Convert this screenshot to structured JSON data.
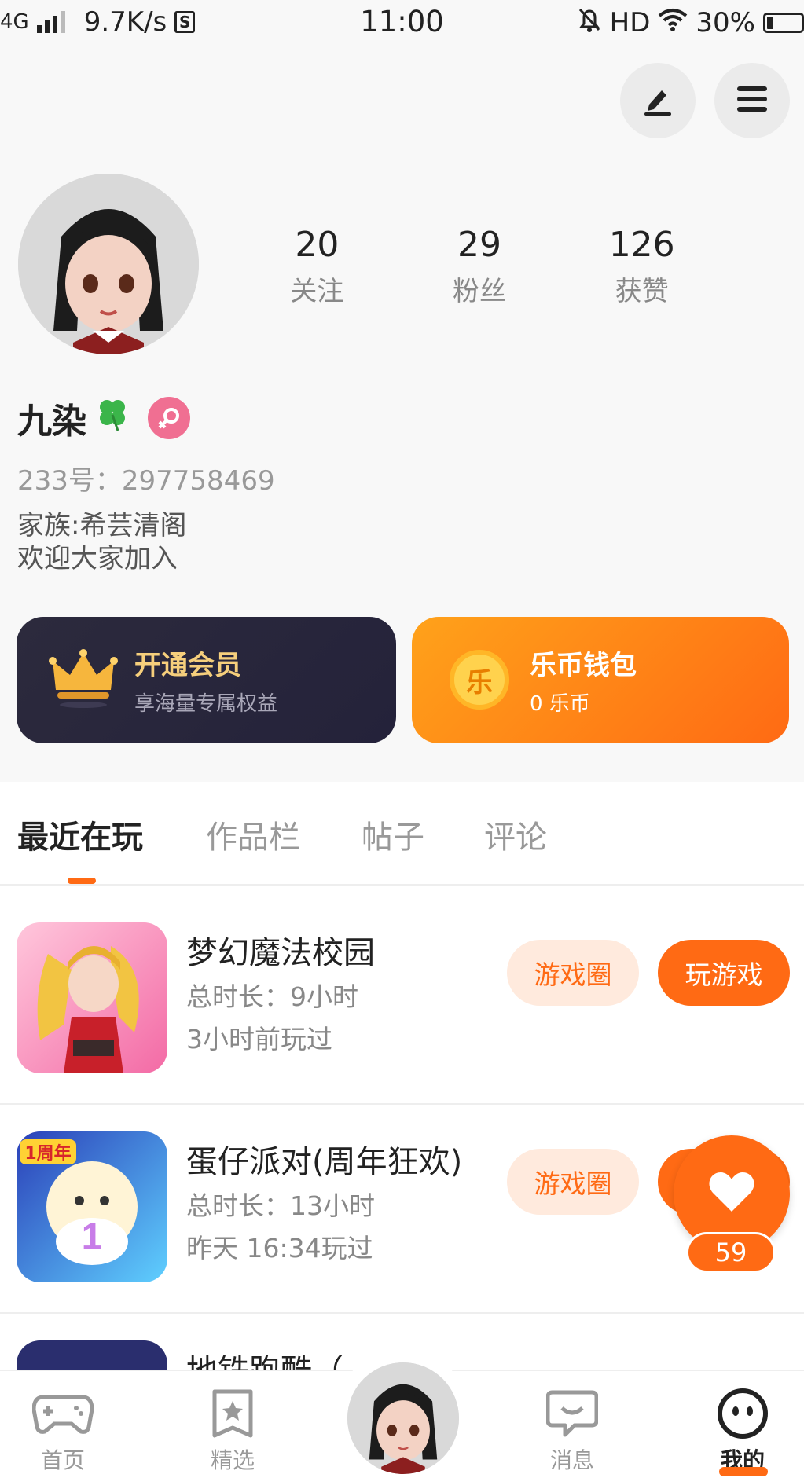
{
  "status_bar": {
    "network": "4G",
    "speed": "9.7K/s",
    "time": "11:00",
    "hd": "HD",
    "battery": "30%"
  },
  "profile": {
    "stats": [
      {
        "value": "20",
        "label": "关注"
      },
      {
        "value": "29",
        "label": "粉丝"
      },
      {
        "value": "126",
        "label": "获赞"
      }
    ],
    "username": "九染",
    "id_line": "233号：297758469",
    "bio_line1": "家族:希芸清阁",
    "bio_line2": "欢迎大家加入"
  },
  "cards": {
    "vip": {
      "title": "开通会员",
      "subtitle": "享海量专属权益"
    },
    "wallet": {
      "title": "乐币钱包",
      "subtitle": "0 乐币",
      "coin_char": "乐"
    }
  },
  "tabs": [
    "最近在玩",
    "作品栏",
    "帖子",
    "评论"
  ],
  "games": [
    {
      "title": "梦幻魔法校园",
      "duration": "总时长：9小时",
      "last_played": "3小时前玩过",
      "circle_btn": "游戏圈",
      "play_btn": "玩游戏"
    },
    {
      "title": "蛋仔派对(周年狂欢)",
      "duration": "总时长：13小时",
      "last_played": "昨天 16:34玩过",
      "circle_btn": "游戏圈",
      "icon_badge": "1周年"
    },
    {
      "title": "地铁跑酷（"
    }
  ],
  "likes": {
    "count": "59"
  },
  "bottom_nav": [
    {
      "label": "首页",
      "icon": "gamepad-icon"
    },
    {
      "label": "精选",
      "icon": "star-bookmark-icon"
    },
    {
      "label": "消息",
      "icon": "chat-bubble-icon"
    },
    {
      "label": "我的",
      "icon": "face-icon"
    }
  ],
  "colors": {
    "accent": "#ff6a14",
    "vip_gold": "#f6cf7c",
    "vip_bg": "#2c2a3d",
    "gender_pink": "#f06f92"
  }
}
